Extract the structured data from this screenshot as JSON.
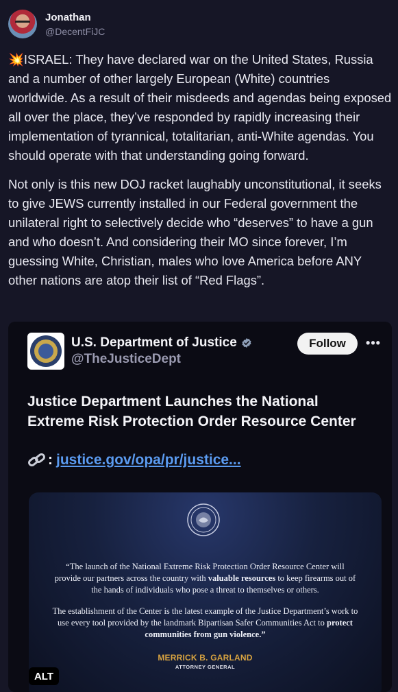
{
  "post": {
    "author": {
      "display_name": "Jonathan",
      "handle": "@DecentFiJC"
    },
    "paragraphs": [
      "💥ISRAEL: They have declared war on the United States, Russia and a number of other largely European (White) countries worldwide. As a result of their misdeeds and agendas being exposed all over the place, they’ve responded by rapidly increasing their implementation of tyrannical, totalitarian, anti-White agendas. You should operate with that understanding going forward.",
      "Not only is this new DOJ racket laughably unconstitutional, it seeks to give JEWS currently installed in our Federal government the unilateral right to selectively decide who “deserves” to have a gun and who doesn’t. And considering their MO since forever, I’m guessing White, Christian, males who love America before ANY other nations are atop their list of “Red Flags”."
    ]
  },
  "embed": {
    "author": {
      "display_name": "U.S. Department of Justice",
      "handle": "@TheJusticeDept",
      "verified": true
    },
    "follow_label": "Follow",
    "more_label": "•••",
    "title": "Justice Department Launches the National Extreme Risk Protection Order Resource Center",
    "link": {
      "icon": "🔗",
      "separator": ":",
      "text": "justice.gov/opa/pr/justice..."
    },
    "image": {
      "quote1_before": "“The launch of the National Extreme Risk Protection Order Resource Center will provide our partners across the country with ",
      "quote1_bold": "valuable resources",
      "quote1_after": " to keep firearms out of the hands of individuals who pose a threat to themselves or others.",
      "quote2_before": "The establishment of the Center is the latest example of the Justice Department’s work to use every tool provided by the landmark Bipartisan Safer Communities Act to ",
      "quote2_bold": "protect communities from gun violence.”",
      "signer_name": "MERRICK B. GARLAND",
      "signer_title": "ATTORNEY GENERAL",
      "alt_label": "ALT"
    }
  },
  "colors": {
    "background": "#161626",
    "link": "#5b9bf0",
    "verified": "#8f9fb8",
    "signer": "#d9a441"
  }
}
